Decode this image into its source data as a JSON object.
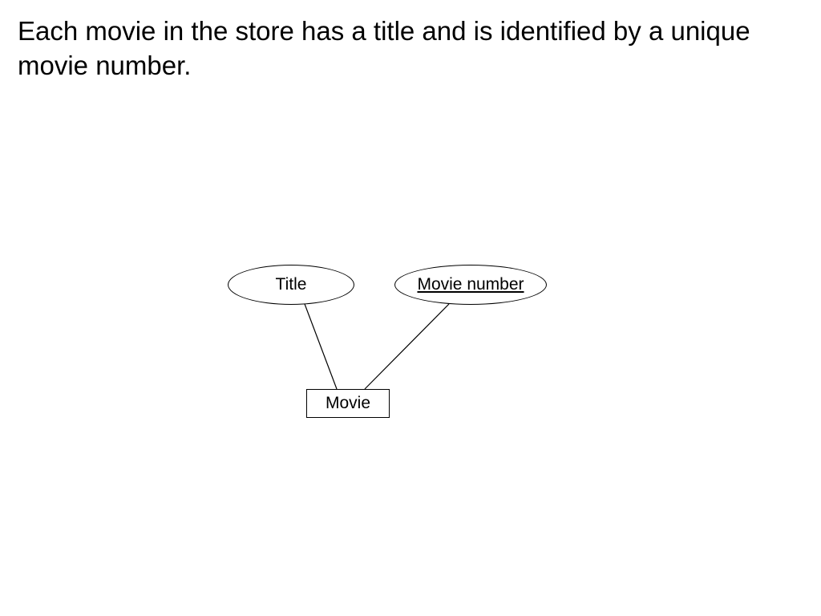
{
  "description_text": "Each movie in the store has a title and is identified by a unique movie number.",
  "diagram": {
    "attribute_title": "Title",
    "attribute_movie_number": "Movie number",
    "entity_movie": "Movie"
  }
}
